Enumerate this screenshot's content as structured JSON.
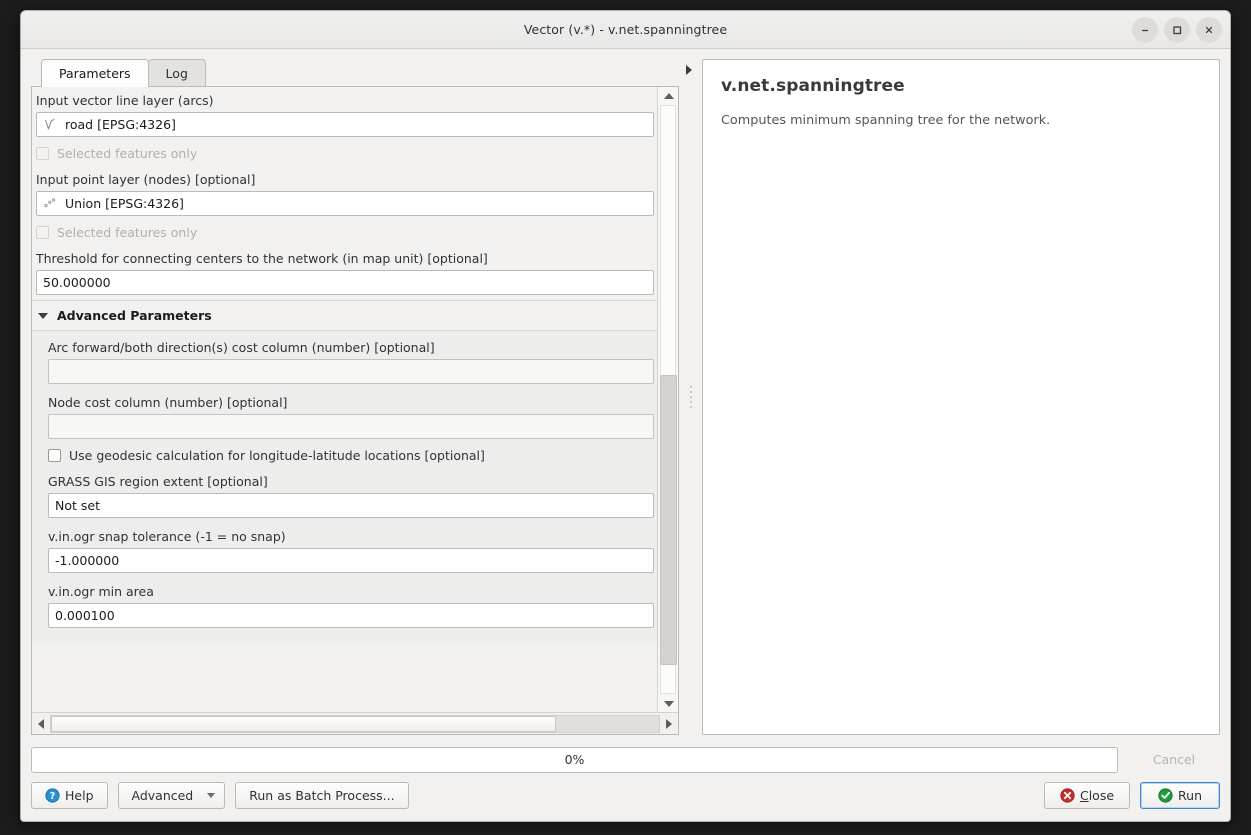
{
  "window": {
    "title": "Vector (v.*) - v.net.spanningtree",
    "controls": [
      {
        "name": "minimize-button",
        "glyph": "minimize"
      },
      {
        "name": "maximize-button",
        "glyph": "maximize"
      },
      {
        "name": "close-button",
        "glyph": "close"
      }
    ]
  },
  "tabs": [
    {
      "label": "Parameters",
      "active": true
    },
    {
      "label": "Log",
      "active": false
    }
  ],
  "parameters": {
    "input_line_layer": {
      "label": "Input vector line layer (arcs)",
      "value": "road [EPSG:4326]",
      "icon": "line-layer-icon"
    },
    "selected_only_1": {
      "label": "Selected features only",
      "checked": false,
      "disabled": true
    },
    "input_point_layer": {
      "label": "Input point layer (nodes) [optional]",
      "value": "Union [EPSG:4326]",
      "icon": "point-layer-icon"
    },
    "selected_only_2": {
      "label": "Selected features only",
      "checked": false,
      "disabled": true
    },
    "threshold": {
      "label": "Threshold for connecting centers to the network (in map unit) [optional]",
      "value": "50.000000"
    }
  },
  "advanced": {
    "header": "Advanced Parameters",
    "expanded": true,
    "arc_cost": {
      "label": "Arc forward/both direction(s) cost column (number) [optional]",
      "value": "",
      "placeholder": ""
    },
    "node_cost": {
      "label": "Node cost column (number) [optional]",
      "value": "",
      "placeholder": ""
    },
    "geodesic": {
      "label": "Use geodesic calculation for longitude-latitude locations [optional]",
      "checked": false
    },
    "region_extent": {
      "label": "GRASS GIS region extent [optional]",
      "value": "Not set"
    },
    "snap_tolerance": {
      "label": "v.in.ogr snap tolerance (-1 = no snap)",
      "value": "-1.000000"
    },
    "min_area": {
      "label": "v.in.ogr min area",
      "value": "0.000100"
    }
  },
  "algorithm": {
    "name": "v.net.spanningtree",
    "description": "Computes minimum spanning tree for the network."
  },
  "progress": {
    "percent_label": "0%",
    "value": 0
  },
  "buttons": {
    "help": "Help",
    "advanced": "Advanced",
    "batch": "Run as Batch Process...",
    "cancel": "Cancel",
    "close_prefix": "C",
    "close_rest": "lose",
    "run": "Run"
  },
  "colors": {
    "accent_blue": "#3b84d6",
    "close_red": "#cc2c2c",
    "run_green": "#1f9c3a",
    "help_blue": "#2a8fd4",
    "window_bg": "#f2f1f0"
  }
}
